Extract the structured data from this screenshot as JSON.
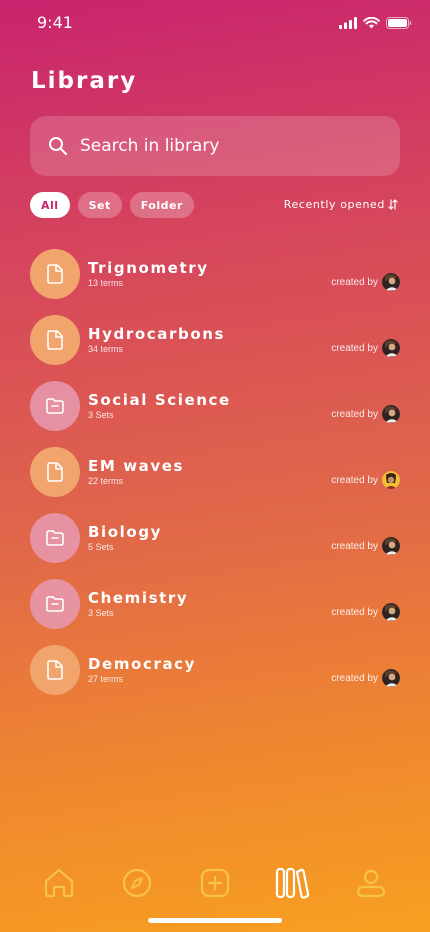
{
  "status_bar": {
    "time": "9:41"
  },
  "header": {
    "title": "Library"
  },
  "search": {
    "placeholder": "Search in library"
  },
  "filters": {
    "chips": [
      {
        "label": "All",
        "active": true
      },
      {
        "label": "Set",
        "active": false
      },
      {
        "label": "Folder",
        "active": false
      }
    ],
    "sort_label": "Recently opened"
  },
  "items": [
    {
      "title": "Trignometry",
      "subtitle": "13 terms",
      "kind": "set",
      "created_label": "created by"
    },
    {
      "title": "Hydrocarbons",
      "subtitle": "34 terms",
      "kind": "set",
      "created_label": "created by"
    },
    {
      "title": "Social Science",
      "subtitle": "3 Sets",
      "kind": "folder",
      "created_label": "created by"
    },
    {
      "title": "EM waves",
      "subtitle": "22 terms",
      "kind": "set",
      "created_label": "created by"
    },
    {
      "title": "Biology",
      "subtitle": "5 Sets",
      "kind": "folder",
      "created_label": "created by"
    },
    {
      "title": "Chemistry",
      "subtitle": "3 Sets",
      "kind": "folder",
      "created_label": "created by"
    },
    {
      "title": "Democracy",
      "subtitle": "27 terms",
      "kind": "set",
      "created_label": "created by"
    }
  ],
  "tabbar": {
    "tabs": [
      {
        "icon": "home-icon",
        "active": false
      },
      {
        "icon": "compass-icon",
        "active": false
      },
      {
        "icon": "add-icon",
        "active": false
      },
      {
        "icon": "library-icon",
        "active": true
      },
      {
        "icon": "profile-icon",
        "active": false
      }
    ]
  },
  "colors": {
    "gradient_top": "#c8246e",
    "gradient_bottom": "#f7a020",
    "set_icon_bg": "#f1a56c",
    "folder_icon_bg": "#e89ab2",
    "tab_inactive": "#f7c24a"
  }
}
